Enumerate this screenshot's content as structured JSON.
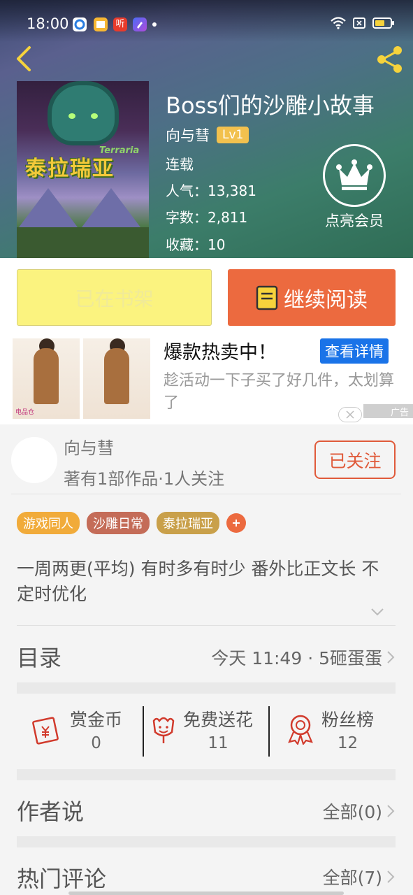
{
  "status_bar": {
    "time": "18:00",
    "app_listen_label": "听",
    "battery_color": "#f6d33c"
  },
  "header": {
    "back_icon": "back-arrow-icon",
    "share_icon": "share-icon"
  },
  "book": {
    "title": "Boss们的沙雕小故事",
    "author": "向与彗",
    "level": "Lv1",
    "status": "连载",
    "popularity": "人气：13,381",
    "word_count": "字数：2,811",
    "favorites": "收藏：10",
    "cover_title": "泰拉瑞亚",
    "cover_subtitle": "Terraria"
  },
  "vip": {
    "label": "点亮会员",
    "icon": "crown-icon"
  },
  "actions": {
    "shelf_label": "已在书架",
    "read_label": "继续阅读",
    "read_icon": "book-icon",
    "read_color": "#ec6a3f"
  },
  "ad": {
    "title": "爆款热卖中！",
    "detail_button": "查看详情",
    "description": "趁活动一下子买了好几件，太划算了",
    "tag": "广告",
    "brand": "电品仓"
  },
  "author_card": {
    "name": "向与彗",
    "info": "著有1部作品·1人关注",
    "follow_label": "已关注"
  },
  "tags": [
    {
      "label": "游戏同人",
      "color": "#f1ab3a"
    },
    {
      "label": "沙雕日常",
      "color": "#c46c58"
    },
    {
      "label": "泰拉瑞亚",
      "color": "#c9a04a"
    }
  ],
  "description": "一周两更(平均) 有时多有时少 番外比正文长 不定时优化",
  "catalog": {
    "title": "目录",
    "right_text": "今天 11:49 · 5砸蛋蛋"
  },
  "stats": [
    {
      "label": "赏金币",
      "value": "0",
      "icon": "reward-envelope-icon"
    },
    {
      "label": "免费送花",
      "value": "11",
      "icon": "flower-icon"
    },
    {
      "label": "粉丝榜",
      "value": "12",
      "icon": "medal-icon"
    }
  ],
  "author_says": {
    "title": "作者说",
    "right_text": "全部(0)"
  },
  "hot_comments": {
    "title": "热门评论",
    "right_text": "全部(7)"
  }
}
